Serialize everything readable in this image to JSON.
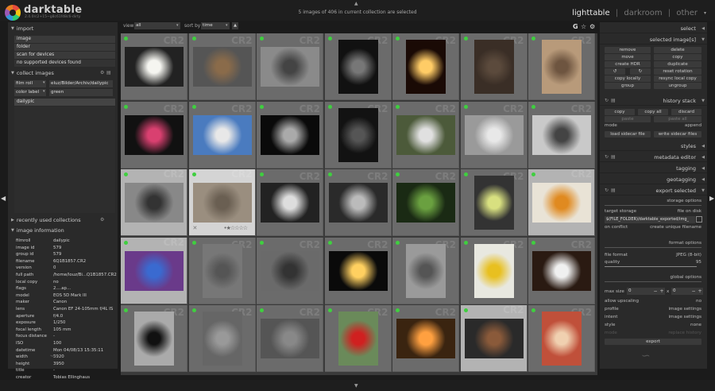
{
  "app": {
    "name": "darktable",
    "version": "2.4.0rc2+15~g8c61fd8c6-dirty"
  },
  "status": "5 images of 406 in current collection are selected",
  "views": {
    "active": "lighttable",
    "items": [
      "lighttable",
      "darkroom",
      "other"
    ],
    "sep": "|"
  },
  "left": {
    "import": {
      "title": "import",
      "items": [
        "image",
        "folder",
        "scan for devices",
        "no supported devices found"
      ]
    },
    "collect": {
      "title": "collect images",
      "rule1_label": "film roll",
      "rule1_value": "eluz/Bilder/Archiv/dailypic",
      "rule2_label": "color label",
      "rule2_value": "green",
      "result": "dailypic"
    },
    "recent": {
      "title": "recently used collections"
    },
    "info": {
      "title": "image information",
      "rows": [
        [
          "filmroll",
          "dailypic"
        ],
        [
          "image id",
          "579"
        ],
        [
          "group id",
          "579"
        ],
        [
          "filename",
          "6Q1B1857.CR2"
        ],
        [
          "version",
          "0"
        ],
        [
          "full path",
          "/home/louz/Bi...Q1B1857.CR2"
        ],
        [
          "local copy",
          "no"
        ],
        [
          "flags",
          "2....ap..."
        ],
        [
          "model",
          "EOS 5D Mark III"
        ],
        [
          "maker",
          "Canon"
        ],
        [
          "lens",
          "Canon EF 24-105mm f/4L IS"
        ],
        [
          "aperture",
          "f/4.0"
        ],
        [
          "exposure",
          "1/250"
        ],
        [
          "focal length",
          "105 mm"
        ],
        [
          "focus distance",
          "-"
        ],
        [
          "ISO",
          "100"
        ],
        [
          "datetime",
          "Mon 04/08/13 15:35:11"
        ],
        [
          "width",
          "5920"
        ],
        [
          "height",
          "3950"
        ],
        [
          "title",
          "-"
        ],
        [
          "creator",
          "Tobias Ellinghaus"
        ],
        [
          "copyright",
          "-"
        ],
        [
          "latitude",
          "-"
        ],
        [
          "longitude",
          "-"
        ],
        [
          "elevation",
          "-"
        ]
      ]
    }
  },
  "filter": {
    "view_label": "view",
    "view_value": "all",
    "sort_label": "sort by",
    "sort_value": "time"
  },
  "right": {
    "select": "select",
    "selected": {
      "title": "selected image[s]",
      "buttons": [
        "remove",
        "delete",
        "move",
        "copy",
        "create HDR",
        "duplicate",
        "↺",
        "↻",
        "reset rotation",
        "copy locally",
        "resync local copy",
        "group",
        "ungroup"
      ]
    },
    "history": {
      "title": "history stack",
      "copy": "copy",
      "copy_all": "copy all",
      "discard": "discard",
      "paste": "paste",
      "paste_all": "paste all",
      "mode_label": "mode",
      "mode_value": "append",
      "load": "load sidecar file",
      "write": "write sidecar files"
    },
    "styles": "styles",
    "metadata": "metadata editor",
    "tagging": "tagging",
    "geotagging": "geotagging",
    "export": {
      "title": "export selected",
      "storage_title": "storage options",
      "target_label": "target storage",
      "target_value": "file on disk",
      "path": "$(FILE_FOLDER)/darktable_exported/img_",
      "conflict_label": "on conflict",
      "conflict_value": "create unique filename",
      "format_title": "format options",
      "format_label": "file format",
      "format_value": "JPEG (8-bit)",
      "quality_label": "quality",
      "quality_value": "95",
      "global_title": "global options",
      "maxsize_label": "max size",
      "maxsize_w": "0",
      "maxsize_x": "x",
      "maxsize_h": "0",
      "upscale_label": "allow upscaling",
      "upscale_value": "no",
      "profile_label": "profile",
      "profile_value": "image settings",
      "intent_label": "intent",
      "intent_value": "image settings",
      "style_label": "style",
      "style_value": "none",
      "mode_label": "mode",
      "mode_value": "replace history",
      "export_button": "export"
    }
  },
  "colors": {
    "accent": "#3fcf3f",
    "panel": "#2a2a2a",
    "grid": "#6b6b6b",
    "selected": "#b3b3b3"
  },
  "thumbnails": [
    {
      "name": "fried-egg",
      "bg": "#222",
      "fg": "#f5f5f0",
      "selected": false
    },
    {
      "name": "owl-figurine",
      "bg": "#555",
      "fg": "#8a6b4a",
      "selected": false
    },
    {
      "name": "hand-with-keys",
      "bg": "#8a8a8a",
      "fg": "#444",
      "selected": false
    },
    {
      "name": "stairwell",
      "bg": "#111",
      "fg": "#777",
      "selected": false
    },
    {
      "name": "lamp-glow",
      "bg": "#1a0a05",
      "fg": "#ffcc66",
      "selected": false
    },
    {
      "name": "boar",
      "bg": "#3a2e26",
      "fg": "#5b4a3c",
      "selected": false
    },
    {
      "name": "alpaca",
      "bg": "#b89a7a",
      "fg": "#6e5540",
      "selected": false
    },
    {
      "name": "candy-hearts",
      "bg": "#111",
      "fg": "#d94070",
      "selected": false
    },
    {
      "name": "blossom-branch",
      "bg": "#4a7bbf",
      "fg": "#e8e8e8",
      "selected": false
    },
    {
      "name": "cigarette",
      "bg": "#0a0a0a",
      "fg": "#aaa",
      "selected": false
    },
    {
      "name": "faucet",
      "bg": "#121212",
      "fg": "#555",
      "selected": false
    },
    {
      "name": "snowdrop",
      "bg": "#4c5a3a",
      "fg": "#e0e0e0",
      "selected": false
    },
    {
      "name": "sink",
      "bg": "#9a9a9a",
      "fg": "#e8e8e8",
      "selected": false
    },
    {
      "name": "cracked-wall",
      "bg": "#c9c9c9",
      "fg": "#444",
      "selected": false
    },
    {
      "name": "street-scene",
      "bg": "#888",
      "fg": "#333",
      "selected": true
    },
    {
      "name": "gravel",
      "bg": "#9a8e7f",
      "fg": "#6a5f52",
      "selected": true,
      "hover": true
    },
    {
      "name": "rail-bars",
      "bg": "#222",
      "fg": "#ddd",
      "selected": false
    },
    {
      "name": "telephone-dial",
      "bg": "#2a2a2a",
      "fg": "#bbb",
      "selected": false
    },
    {
      "name": "fern",
      "bg": "#1a2a14",
      "fg": "#6aa040",
      "selected": false
    },
    {
      "name": "pear-in-hand",
      "bg": "#333",
      "fg": "#d8e080",
      "selected": false
    },
    {
      "name": "orange-drink",
      "bg": "#e9e3d6",
      "fg": "#e08a20",
      "selected": true
    },
    {
      "name": "colored-hair",
      "bg": "#6a3a8a",
      "fg": "#3a6ad0",
      "selected": true
    },
    {
      "name": "coin-logo",
      "bg": "#777",
      "fg": "#555",
      "selected": false
    },
    {
      "name": "fabric-closeup",
      "bg": "#6a6a6a",
      "fg": "#333",
      "selected": false
    },
    {
      "name": "lights-row",
      "bg": "#0a0a0a",
      "fg": "#ffd060",
      "selected": false
    },
    {
      "name": "graffiti-wall",
      "bg": "#9a9a9a",
      "fg": "#555",
      "selected": false
    },
    {
      "name": "yellow-flowers",
      "bg": "#e8e8e0",
      "fg": "#e8c020",
      "selected": false
    },
    {
      "name": "spaniel",
      "bg": "#2a1a12",
      "fg": "#f0f0f0",
      "selected": false
    },
    {
      "name": "arched-door",
      "bg": "#aaa",
      "fg": "#111",
      "selected": false
    },
    {
      "name": "stone-arch",
      "bg": "#666",
      "fg": "#999",
      "selected": false
    },
    {
      "name": "roof-tiles",
      "bg": "#555",
      "fg": "#888",
      "selected": false
    },
    {
      "name": "red-tulip",
      "bg": "#6a8a5a",
      "fg": "#d02020",
      "selected": false
    },
    {
      "name": "candle-jar",
      "bg": "#3a2410",
      "fg": "#ffa040",
      "selected": false
    },
    {
      "name": "hat-shell",
      "bg": "#2a2a2a",
      "fg": "#8a5a3a",
      "selected": true
    },
    {
      "name": "orange-building",
      "bg": "#c0503a",
      "fg": "#f0d0b0",
      "selected": false
    }
  ]
}
